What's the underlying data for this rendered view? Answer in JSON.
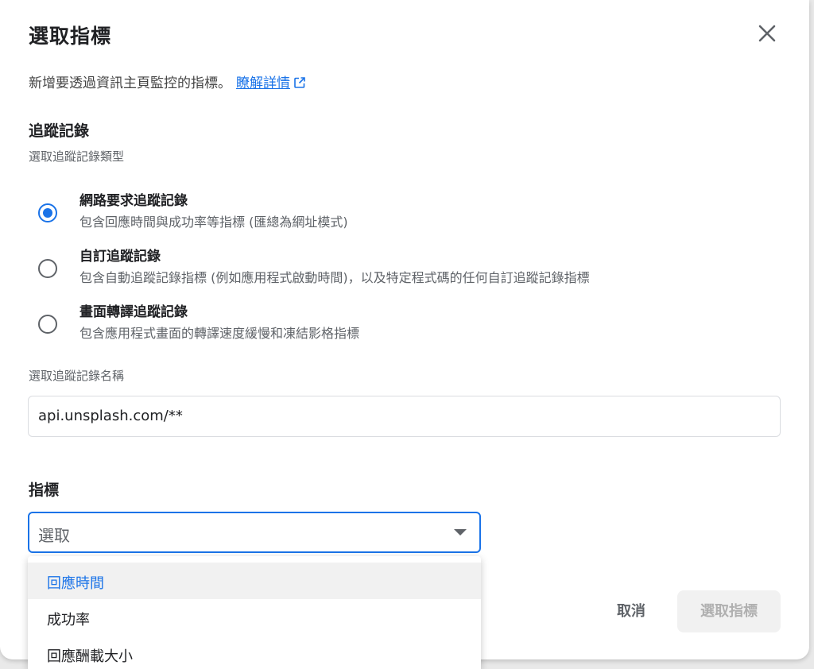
{
  "dialog": {
    "title": "選取指標",
    "subtitle": "新增要透過資訊主頁監控的指標。",
    "learn_more": "瞭解詳情"
  },
  "trace": {
    "heading": "追蹤記錄",
    "subheading": "選取追蹤記錄類型",
    "options": [
      {
        "title": "網路要求追蹤記錄",
        "desc": "包含回應時間與成功率等指標 (匯總為網址模式)",
        "selected": true
      },
      {
        "title": "自訂追蹤記錄",
        "desc": "包含自動追蹤記錄指標 (例如應用程式啟動時間)，以及特定程式碼的任何自訂追蹤記錄指標",
        "selected": false
      },
      {
        "title": "畫面轉譯追蹤記錄",
        "desc": "包含應用程式畫面的轉譯速度緩慢和凍結影格指標",
        "selected": false
      }
    ],
    "name_label": "選取追蹤記錄名稱",
    "name_value": "api.unsplash.com/**"
  },
  "metric": {
    "heading": "指標",
    "placeholder": "選取",
    "options": [
      "回應時間",
      "成功率",
      "回應酬載大小"
    ],
    "highlighted": "回應時間"
  },
  "actions": {
    "cancel": "取消",
    "confirm": "選取指標"
  },
  "colors": {
    "accent": "#1a73e8",
    "disabled_bg": "#f1f1f1",
    "disabled_text": "#b0b0b0"
  },
  "icons": {
    "close": "close-icon",
    "external_link": "external-link-icon",
    "dropdown": "dropdown-caret-icon"
  }
}
